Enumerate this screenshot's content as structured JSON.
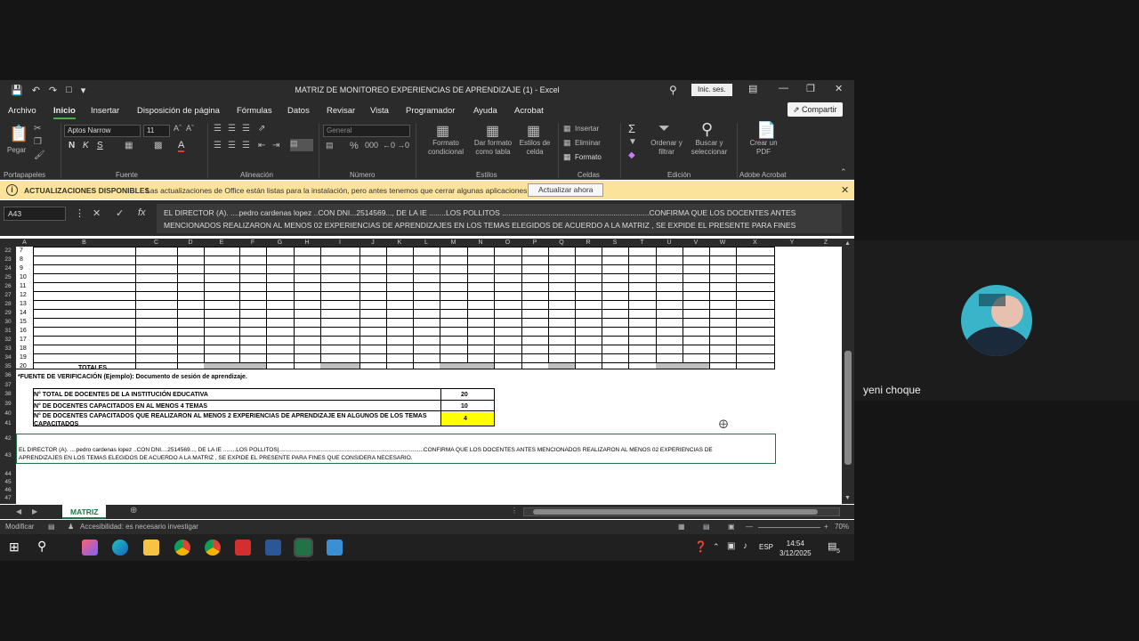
{
  "window": {
    "title": "MATRIZ DE MONITOREO EXPERIENCIAS DE APRENDIZAJE (1) - Excel",
    "signin_label": "Inic. ses."
  },
  "menu": {
    "tabs": [
      "Archivo",
      "Inicio",
      "Insertar",
      "Disposición de página",
      "Fórmulas",
      "Datos",
      "Revisar",
      "Vista",
      "Programador",
      "Ayuda",
      "Acrobat"
    ],
    "share_label": "Compartir"
  },
  "ribbon": {
    "font_name": "Aptos Narrow",
    "font_size": "11",
    "number_format": "General",
    "paste_label": "Pegar",
    "insert_label": "Insertar",
    "delete_label": "Eliminar",
    "format_label": "Formato",
    "cond_format_label": "Formato condicional",
    "table_format_label": "Dar formato como tabla",
    "cell_styles_label": "Estilos de celda",
    "sort_label": "Ordenar y filtrar",
    "find_label": "Buscar y seleccionar",
    "pdf_label": "Crear un PDF",
    "groups": [
      "Portapapeles",
      "Fuente",
      "Alineación",
      "Número",
      "Estilos",
      "Celdas",
      "Edición",
      "Adobe Acrobat"
    ]
  },
  "notification": {
    "heading": "ACTUALIZACIONES DISPONIBLES",
    "message": "Las actualizaciones de Office están listas para la instalación, pero antes tenemos que cerrar algunas aplicaciones.",
    "button": "Actualizar ahora"
  },
  "formula_bar": {
    "cell_ref": "A43",
    "content": "EL DIRECTOR (A). ....pedro cardenas lopez ..CON DNI...2514569..., DE LA IE ........LOS POLLITOS ......................................................................CONFIRMA QUE LOS DOCENTES ANTES MENCIONADOS REALIZARON AL MENOS 02 EXPERIENCIAS DE APRENDIZAJES EN LOS TEMAS ELEGIDOS DE ACUERDO A LA MATRIZ , SE EXPIDE EL PRESENTE PARA FINES"
  },
  "grid": {
    "columns": [
      "A",
      "B",
      "C",
      "D",
      "E",
      "F",
      "G",
      "H",
      "I",
      "J",
      "K",
      "L",
      "M",
      "N",
      "O",
      "P",
      "Q",
      "R",
      "S",
      "T",
      "U",
      "V",
      "W",
      "X",
      "Y",
      "Z"
    ],
    "row_numbers": [
      "22",
      "23",
      "24",
      "25",
      "26",
      "27",
      "28",
      "29",
      "30",
      "31",
      "32",
      "33",
      "34",
      "35",
      "36",
      "37",
      "38",
      "39",
      "40",
      "41",
      "42",
      "43",
      "44",
      "45",
      "46",
      "47"
    ],
    "index_values": [
      "7",
      "8",
      "9",
      "10",
      "11",
      "12",
      "13",
      "14",
      "15",
      "16",
      "17",
      "18",
      "19",
      "20"
    ],
    "totales_label": "TOTALES",
    "fuente_note": "*FUENTE DE VERIFICACIÓN (Ejemplo): Documento de sesión de aprendizaje.",
    "summary": [
      {
        "label": "N° TOTAL DE DOCENTES DE LA INSTITUCIÓN EDUCATIVA",
        "value": "20"
      },
      {
        "label": "N° DE DOCENTES CAPACITADOS EN AL MENOS 4 TEMAS",
        "value": "10"
      },
      {
        "label": "N° DE DOCENTES CAPACITADOS QUE REALIZARON AL MENOS 2 EXPERIENCIAS DE APRENDIZAJE EN ALGUNOS DE LOS TEMAS CAPACITADOS",
        "value": "4"
      }
    ],
    "certificate_line1": "EL DIRECTOR (A). ....pedro cardenas lopez ..CON DNI....2514569..., DE LA IE ........LOS POLLITOS|..........................................................................................CONFIRMA QUE LOS DOCENTES ANTES MENCIONADOS REALIZARON AL MENOS 02 EXPERIENCIAS DE",
    "certificate_line2": "APRENDIZAJES EN LOS TEMAS ELEGIDOS DE ACUERDO A LA MATRIZ , SE EXPIDE EL PRESENTE PARA FINES QUE CONSIDERA NECESARIO."
  },
  "sheet_tabs": [
    "MATRIZ"
  ],
  "status": {
    "mode": "Modificar",
    "accessibility": "Accesibilidad: es necesario investigar",
    "zoom": "70%"
  },
  "taskbar": {
    "language": "ESP",
    "time": "14:54",
    "date": "3/12/2025",
    "notifications": "5"
  },
  "call": {
    "participant_name": "yeni choque"
  },
  "colors": {
    "excel_green": "#217346",
    "highlight_yellow": "#ffff00",
    "notify_bg": "#fbe39b"
  }
}
